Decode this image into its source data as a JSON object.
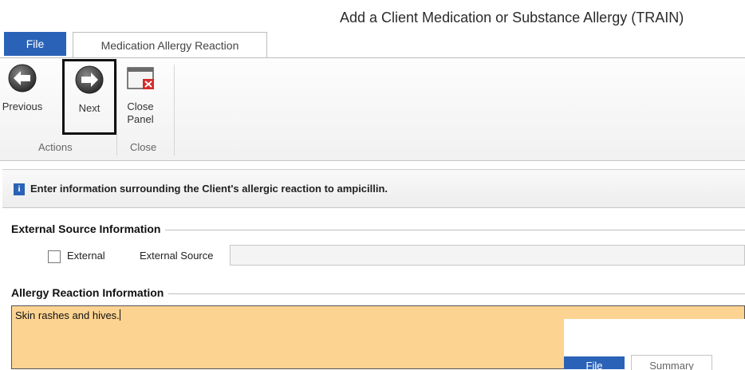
{
  "window": {
    "title": "Add a Client Medication or Substance Allergy (TRAIN)"
  },
  "tabs": [
    {
      "label": "File"
    },
    {
      "label": "Medication Allergy Reaction"
    }
  ],
  "ribbon": {
    "buttons": [
      {
        "label": "Previous",
        "icon": "arrow-left-circle-icon"
      },
      {
        "label": "Next",
        "icon": "arrow-right-circle-icon"
      },
      {
        "label": "Close Panel",
        "icon": "close-window-icon"
      }
    ],
    "groups": [
      {
        "label": "Actions"
      },
      {
        "label": "Close"
      }
    ]
  },
  "info": {
    "icon": "info-icon",
    "text": "Enter information surrounding the Client's allergic reaction to ampicillin."
  },
  "external_source": {
    "heading": "External Source Information",
    "external_label": "External",
    "external_checked": false,
    "source_label": "External Source",
    "source_value": ""
  },
  "allergy_reaction": {
    "heading": "Allergy Reaction Information",
    "value": "Skin rashes and hives."
  },
  "overlay": {
    "tabs": [
      {
        "label": "File"
      },
      {
        "label": "Summary"
      }
    ]
  },
  "colors": {
    "file_tab": "#2a62b7",
    "reaction_field": "#fcd391",
    "highlight_border": "#111111"
  }
}
